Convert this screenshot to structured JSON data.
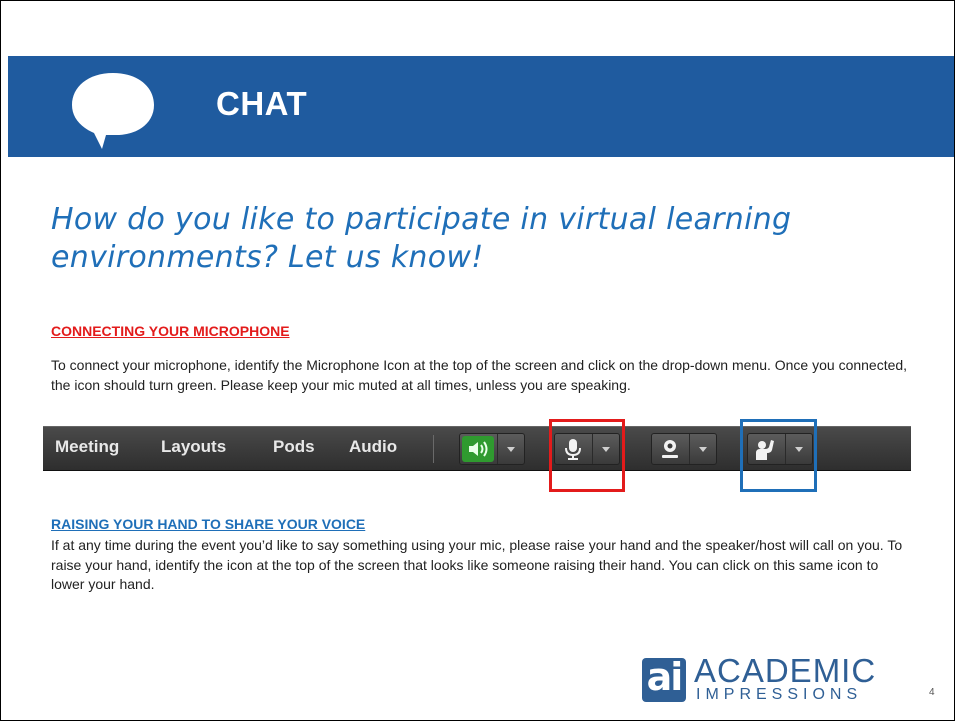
{
  "banner": {
    "title": "CHAT",
    "color": "#1f5b9f"
  },
  "question": "How do you like to participate in virtual learning environments?  Let us know!",
  "microphone_section": {
    "heading": "CONNECTING YOUR MICROPHONE",
    "body": "To connect your microphone, identify the Microphone Icon at the top of the screen and click on the drop-down menu. Once you connected, the icon should turn green.  Please keep your mic muted at all times, unless you are speaking."
  },
  "toolbar": {
    "menus": [
      "Meeting",
      "Layouts",
      "Pods",
      "Audio"
    ],
    "buttons": [
      "speaker-icon",
      "microphone-icon",
      "webcam-icon",
      "raise-hand-icon"
    ]
  },
  "hand_section": {
    "heading": "RAISING YOUR HAND TO SHARE YOUR VOICE",
    "body": "If at any time during the event you’d like to say something using your mic, please raise your hand and the speaker/host will call on you.  To raise your hand, identify the icon at the top of the screen that looks like someone raising their hand.  You can click on this same icon to lower your hand."
  },
  "logo": {
    "mark": "ai",
    "top": "ACADEMIC",
    "bottom": "IMPRESSIONS"
  },
  "page_number": "4",
  "colors": {
    "red": "#e31b1b",
    "blue": "#1f6fb8",
    "speaker_green": "#3cc43c"
  }
}
